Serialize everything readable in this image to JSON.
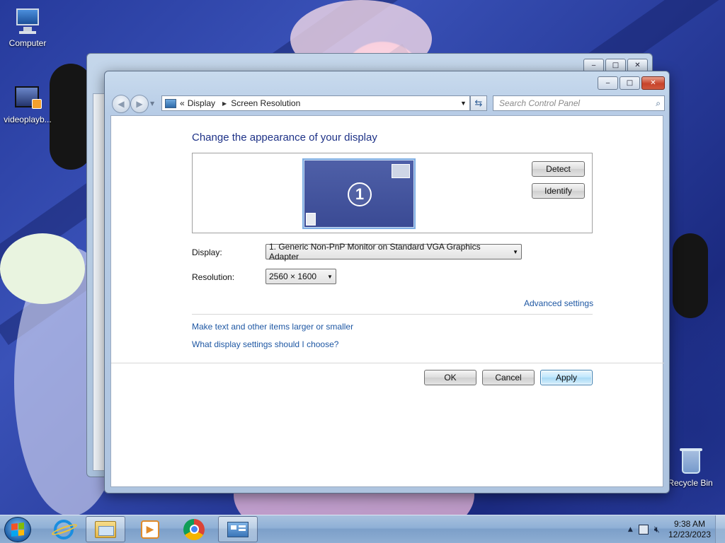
{
  "desktop": {
    "icons": [
      {
        "label": "Computer",
        "icon": "computer-icon"
      },
      {
        "label": "videoplayb...",
        "icon": "video-file-icon"
      },
      {
        "label": "Recycle Bin",
        "icon": "recycle-bin-icon"
      }
    ]
  },
  "window": {
    "caption_buttons": {
      "minimize": "‒",
      "maximize": "□",
      "close": "✕"
    },
    "breadcrumb": {
      "chevrons": "«",
      "items": [
        "Display",
        "Screen Resolution"
      ]
    },
    "search": {
      "placeholder": "Search Control Panel"
    },
    "heading": "Change the appearance of your display",
    "monitor_number": "1",
    "detect_label": "Detect",
    "identify_label": "Identify",
    "display_label": "Display:",
    "display_value": "1. Generic Non-PnP Monitor on Standard VGA Graphics Adapter",
    "resolution_label": "Resolution:",
    "resolution_value": "2560 × 1600",
    "advanced_link": "Advanced settings",
    "links": [
      "Make text and other items larger or smaller",
      "What display settings should I choose?"
    ],
    "ok_label": "OK",
    "cancel_label": "Cancel",
    "apply_label": "Apply"
  },
  "taskbar": {
    "items": [
      {
        "icon": "internet-explorer-icon",
        "active": false
      },
      {
        "icon": "file-explorer-icon",
        "active": true
      },
      {
        "icon": "media-player-icon",
        "active": false
      },
      {
        "icon": "chrome-icon",
        "active": false
      },
      {
        "icon": "control-panel-icon",
        "active": true
      }
    ],
    "time": "9:38 AM",
    "date": "12/23/2023"
  },
  "colors": {
    "accent": "#1e3287",
    "link": "#1e57a3"
  }
}
